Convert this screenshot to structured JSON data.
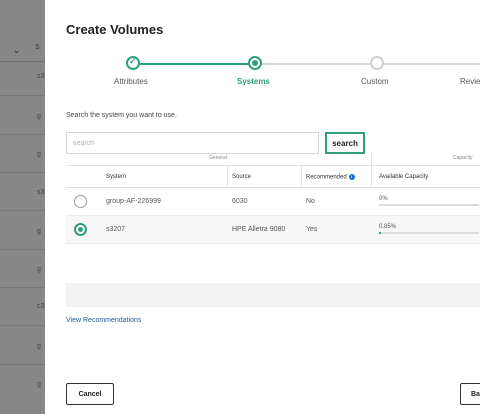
{
  "background": {
    "column_header": "S",
    "rows": [
      "s3",
      "g",
      "g",
      "s3",
      "g",
      "g",
      "c3",
      "g",
      "g"
    ]
  },
  "modal": {
    "title": "Create Volumes",
    "steps": [
      {
        "label": "Attributes",
        "state": "done"
      },
      {
        "label": "Systems",
        "state": "current"
      },
      {
        "label": "Custom",
        "state": "pending"
      },
      {
        "label": "Revie",
        "state": "pending"
      }
    ],
    "instruction": "Search the system you want to use.",
    "search": {
      "placeholder": "search",
      "button_label": "search"
    },
    "table": {
      "groups": {
        "general": "General",
        "capacity": "Capacity"
      },
      "columns": [
        "System",
        "Source",
        "Recommended",
        "Available Capacity"
      ],
      "rows": [
        {
          "system": "group-AF-226999",
          "source": "6030",
          "recommended": "No",
          "capacity_label": "0%",
          "capacity_fraction": 0.0,
          "selected": false
        },
        {
          "system": "s3207",
          "source": "HPE Alletra 9080",
          "recommended": "Yes",
          "capacity_label": "0.85%",
          "capacity_fraction": 0.0085,
          "selected": true
        }
      ]
    },
    "view_recommendations": "View Recommendations",
    "cancel_label": "Cancel",
    "back_label": "Ba"
  },
  "colors": {
    "accent": "#2e9e7f",
    "link": "#1d5b91",
    "info": "#1e6fd0"
  }
}
